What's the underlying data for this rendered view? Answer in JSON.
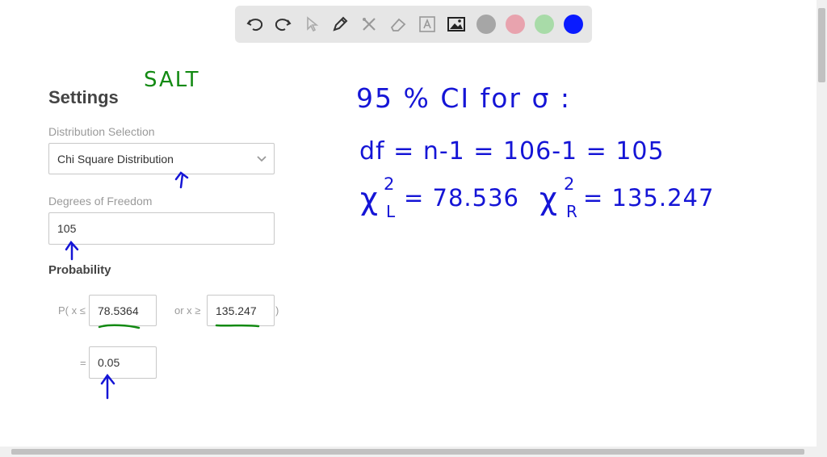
{
  "toolbar": {
    "tools": [
      "undo-icon",
      "redo-icon",
      "pointer-icon",
      "pen-icon",
      "tools-icon",
      "eraser-icon",
      "text-icon",
      "image-icon"
    ],
    "colors": [
      "#a6a6a6",
      "#e8a3ae",
      "#a8dba8",
      "#0a1bff"
    ]
  },
  "settings": {
    "title": "Settings",
    "distribution_label": "Distribution Selection",
    "distribution_value": "Chi Square Distribution",
    "dof_label": "Degrees of Freedom",
    "dof_value": "105",
    "probability_title": "Probability",
    "p_prefix": "P( x ≤",
    "left_value": "78.5364",
    "or_label": "or x ≥",
    "right_value": "135.247",
    "close_paren": ")",
    "equals": "=",
    "prob_value": "0.05"
  },
  "annotations": {
    "salt": "SALT",
    "line1": "95 % CI for σ :",
    "line2": "df = n-1 = 106-1 = 105",
    "chi_left_base": "χ",
    "chi_left_sup": "2",
    "chi_left_sub": "L",
    "chi_left_val": "= 78.536",
    "chi_right_base": "χ",
    "chi_right_sup": "2",
    "chi_right_sub": "R",
    "chi_right_val": "= 135.247",
    "colors": {
      "green": "#138a13",
      "blue": "#1515d6"
    }
  }
}
